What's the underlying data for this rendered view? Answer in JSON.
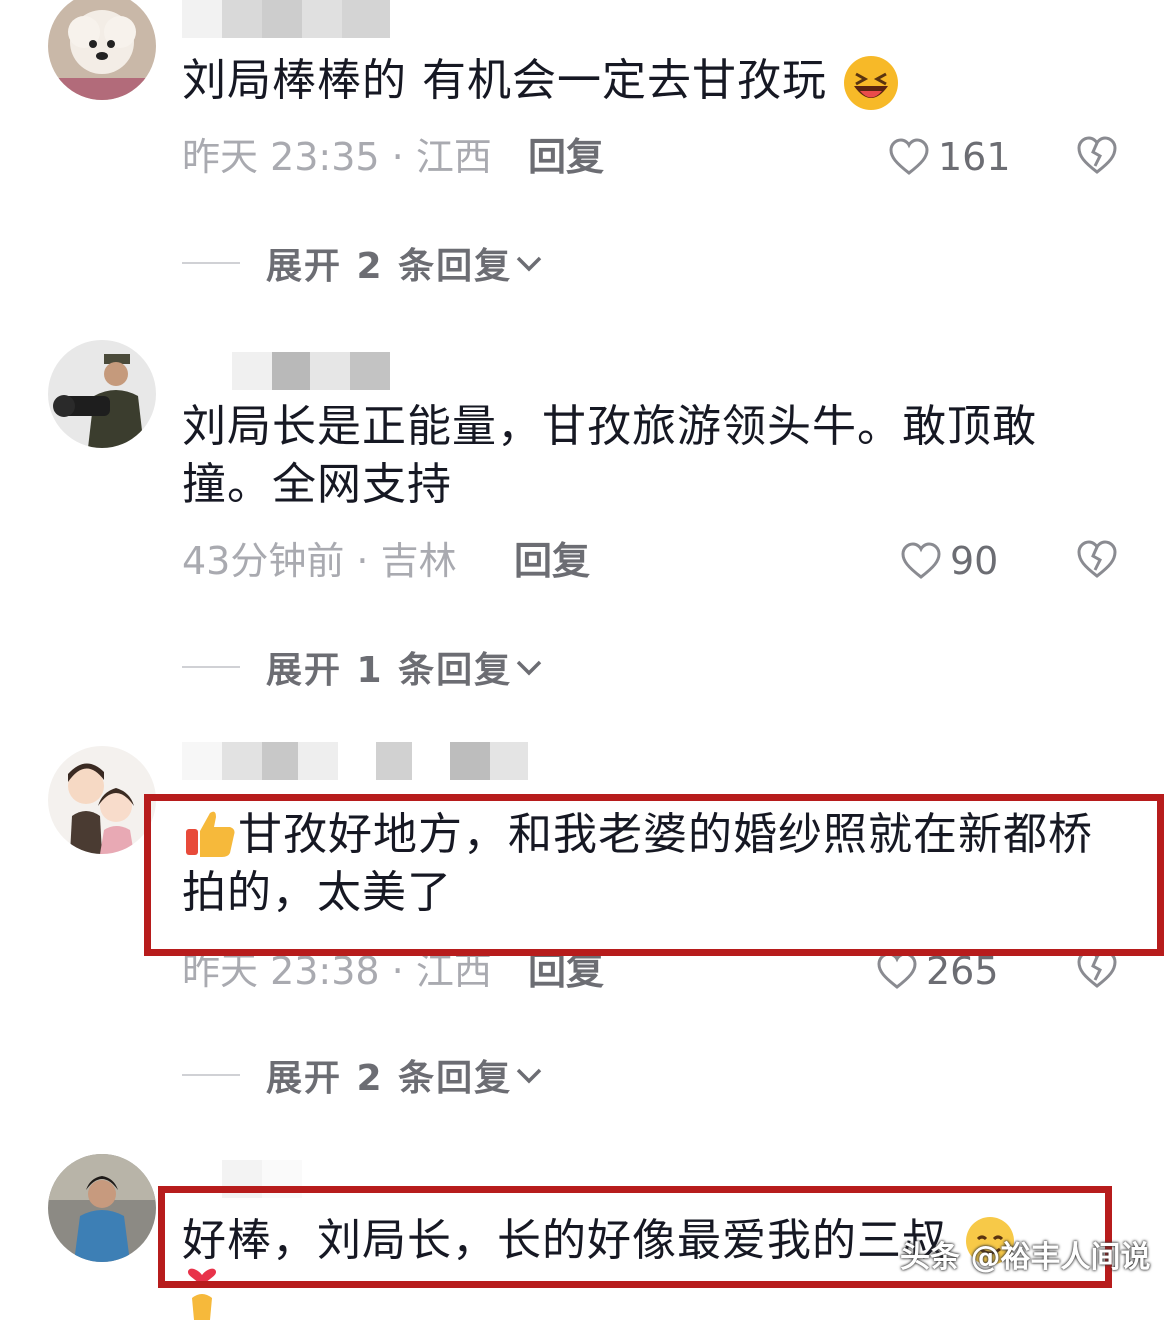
{
  "comments": [
    {
      "text": "刘局棒棒的 有机会一定去甘孜玩",
      "time": "昨天 23:35 · 江西",
      "reply_label": "回复",
      "likes": "161",
      "expand_label": "展开 2 条回复"
    },
    {
      "text": "刘局长是正能量，甘孜旅游领头牛。敢顶敢撞。全网支持",
      "time": "43分钟前 · 吉林",
      "reply_label": "回复",
      "likes": "90",
      "expand_label": "展开 1 条回复"
    },
    {
      "text": "甘孜好地方，和我老婆的婚纱照就在新都桥拍的，太美了",
      "time": "昨天 23:38 · 江西",
      "reply_label": "回复",
      "likes": "265",
      "expand_label": "展开 2 条回复"
    },
    {
      "text": "好棒，刘局长，长的好像最爱我的三叔"
    }
  ],
  "watermark": "头条 @裕丰人间说",
  "colors": {
    "text": "#161823",
    "meta": "#a9aab0",
    "action": "#6c6d73",
    "highlight": "#b71c1c"
  }
}
